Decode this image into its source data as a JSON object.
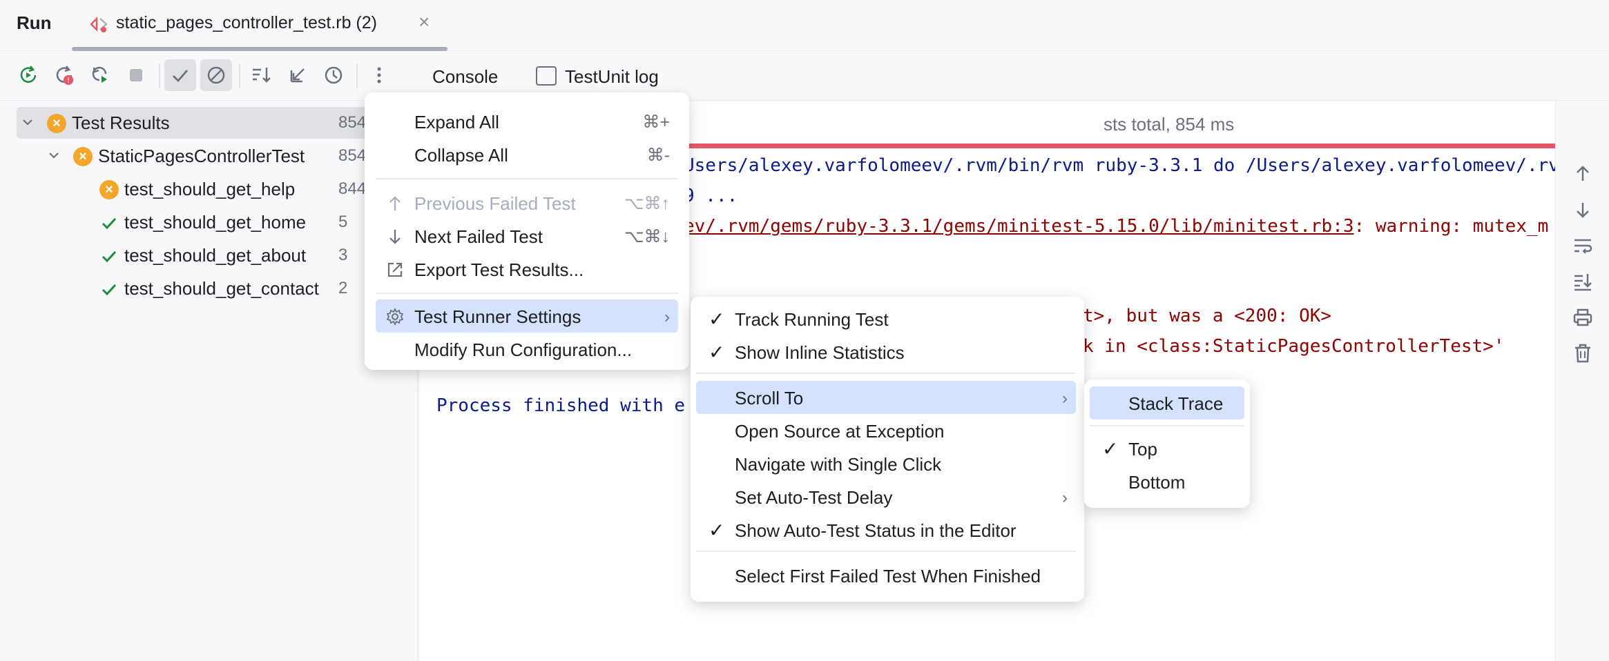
{
  "topbar": {
    "run_label": "Run",
    "tab_title": "static_pages_controller_test.rb (2)",
    "close_glyph": "×"
  },
  "toolbar": {
    "buttons": [
      "rerun-icon",
      "rerun-failed-icon",
      "toggle-auto-test-icon",
      "stop-icon",
      "show-passed-icon",
      "show-ignored-icon",
      "sort-icon",
      "collapse-icon",
      "history-icon",
      "more-icon"
    ],
    "console_tab": "Console",
    "log_tab": "TestUnit log"
  },
  "tree": {
    "items": [
      {
        "name": "Test Results",
        "time": "854",
        "status": "failed"
      },
      {
        "name": "StaticPagesControllerTest",
        "time": "854",
        "status": "failed"
      },
      {
        "name": "test_should_get_help",
        "time": "844",
        "status": "failed"
      },
      {
        "name": "test_should_get_home",
        "time": "5",
        "status": "passed"
      },
      {
        "name": "test_should_get_about",
        "time": "3",
        "status": "passed"
      },
      {
        "name": "test_should_get_contact",
        "time": "2",
        "status": "passed"
      }
    ]
  },
  "console": {
    "header": "sts total, 854 ms",
    "line1": "Users/alexey.varfolomeev/.rvm/bin/rvm ruby-3.3.1 do /Users/alexey.varfolomeev/.rv",
    "line2": "9 ...",
    "line3_link": "ev/.rvm/gems/ruby-3.3.1/gems/minitest-5.15.0/lib/minitest.rb:3",
    "line3_rest": ": warning: mutex_m",
    "line4": "t>, but was a <200: OK>",
    "line5": "k in <class:StaticPagesControllerTest>'",
    "line6": "Process finished with e"
  },
  "menu1": {
    "expand_all": "Expand All",
    "expand_all_sc": "⌘+",
    "collapse_all": "Collapse All",
    "collapse_all_sc": "⌘-",
    "prev_failed": "Previous Failed Test",
    "prev_failed_sc": "⌥⌘↑",
    "next_failed": "Next Failed Test",
    "next_failed_sc": "⌥⌘↓",
    "export": "Export Test Results...",
    "runner_settings": "Test Runner Settings",
    "modify_run": "Modify Run Configuration..."
  },
  "menu2": {
    "track_running": "Track Running Test",
    "inline_stats": "Show Inline Statistics",
    "scroll_to": "Scroll To",
    "open_source": "Open Source at Exception",
    "navigate_single": "Navigate with Single Click",
    "auto_test_delay": "Set Auto-Test Delay",
    "auto_test_status": "Show Auto-Test Status in the Editor",
    "select_first_failed": "Select First Failed Test When Finished",
    "check_glyph": "✓"
  },
  "menu3": {
    "stack_trace": "Stack Trace",
    "top": "Top",
    "bottom": "Bottom"
  },
  "colors": {
    "accent": "#d4e2ff",
    "fail": "#f2a72b",
    "pass": "#208a3c",
    "progress_fail": "#e55765"
  }
}
